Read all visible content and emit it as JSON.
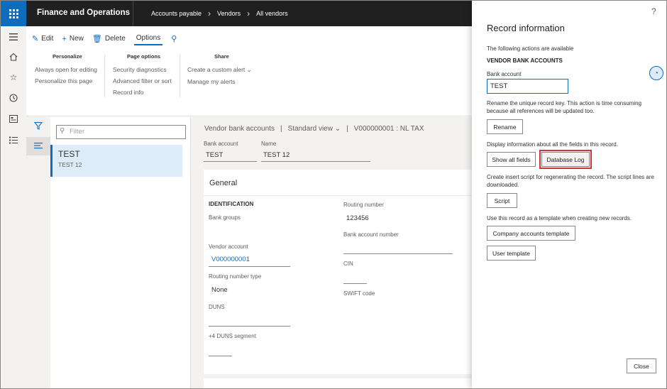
{
  "header": {
    "app_title": "Finance and Operations",
    "breadcrumbs": [
      "Accounts payable",
      "Vendors",
      "All vendors"
    ]
  },
  "action_pane": {
    "tabs": {
      "edit": "Edit",
      "new": "New",
      "delete": "Delete",
      "options": "Options"
    },
    "groups": {
      "personalize": {
        "title": "Personalize",
        "items": [
          "Always open for editing",
          "Personalize this page"
        ]
      },
      "page_options": {
        "title": "Page options",
        "items": [
          "Security diagnostics",
          "Advanced filter or sort",
          "Record info"
        ]
      },
      "share": {
        "title": "Share",
        "items": [
          "Create a custom alert",
          "Manage my alerts"
        ]
      }
    }
  },
  "list": {
    "filter_placeholder": "Filter",
    "items": [
      {
        "title": "TEST",
        "subtitle": "TEST 12"
      }
    ]
  },
  "form": {
    "header": {
      "entity": "Vendor bank accounts",
      "view": "Standard view",
      "record": "V000000001 : NL TAX"
    },
    "bank_account": {
      "label": "Bank account",
      "value": "TEST"
    },
    "name": {
      "label": "Name",
      "value": "TEST 12"
    },
    "general": {
      "title": "General",
      "identification": "IDENTIFICATION",
      "bank_groups": {
        "label": "Bank groups",
        "value": ""
      },
      "vendor_account": {
        "label": "Vendor account",
        "value": "V000000001"
      },
      "routing_number_type": {
        "label": "Routing number type",
        "value": "None"
      },
      "duns": {
        "label": "DUNS",
        "value": ""
      },
      "duns_segment": {
        "label": "+4 DUNS segment",
        "value": ""
      },
      "routing_number": {
        "label": "Routing number",
        "value": "123456"
      },
      "bank_account_number": {
        "label": "Bank account number",
        "value": ""
      },
      "cin": {
        "label": "CIN",
        "value": ""
      },
      "swift_code": {
        "label": "SWIFT code",
        "value": ""
      }
    }
  },
  "panel": {
    "help": "?",
    "title": "Record information",
    "intro": "The following actions are available",
    "section": "VENDOR BANK ACCOUNTS",
    "bank_account_label": "Bank account",
    "bank_account_value": "TEST",
    "rename_desc": "Rename the unique record key. This action is time consuming because all references will be updated too.",
    "rename_btn": "Rename",
    "fields_desc": "Display information about all the fields in this record.",
    "show_all_fields_btn": "Show all fields",
    "database_log_btn": "Database Log",
    "script_desc": "Create insert script for regenerating the record. The script lines are downloaded.",
    "script_btn": "Script",
    "template_desc": "Use this record as a template when creating new records.",
    "company_template_btn": "Company accounts template",
    "user_template_btn": "User template",
    "close_btn": "Close"
  },
  "icons": [
    "waffle-icon",
    "hamburger-icon",
    "home-icon",
    "star-icon",
    "clock-icon",
    "workspace-icon",
    "list-icon",
    "filter-icon",
    "search-icon",
    "edit-icon",
    "add-icon",
    "delete-icon",
    "chevron-down-icon",
    "chevron-right-icon",
    "help-icon",
    "copilot-icon"
  ]
}
